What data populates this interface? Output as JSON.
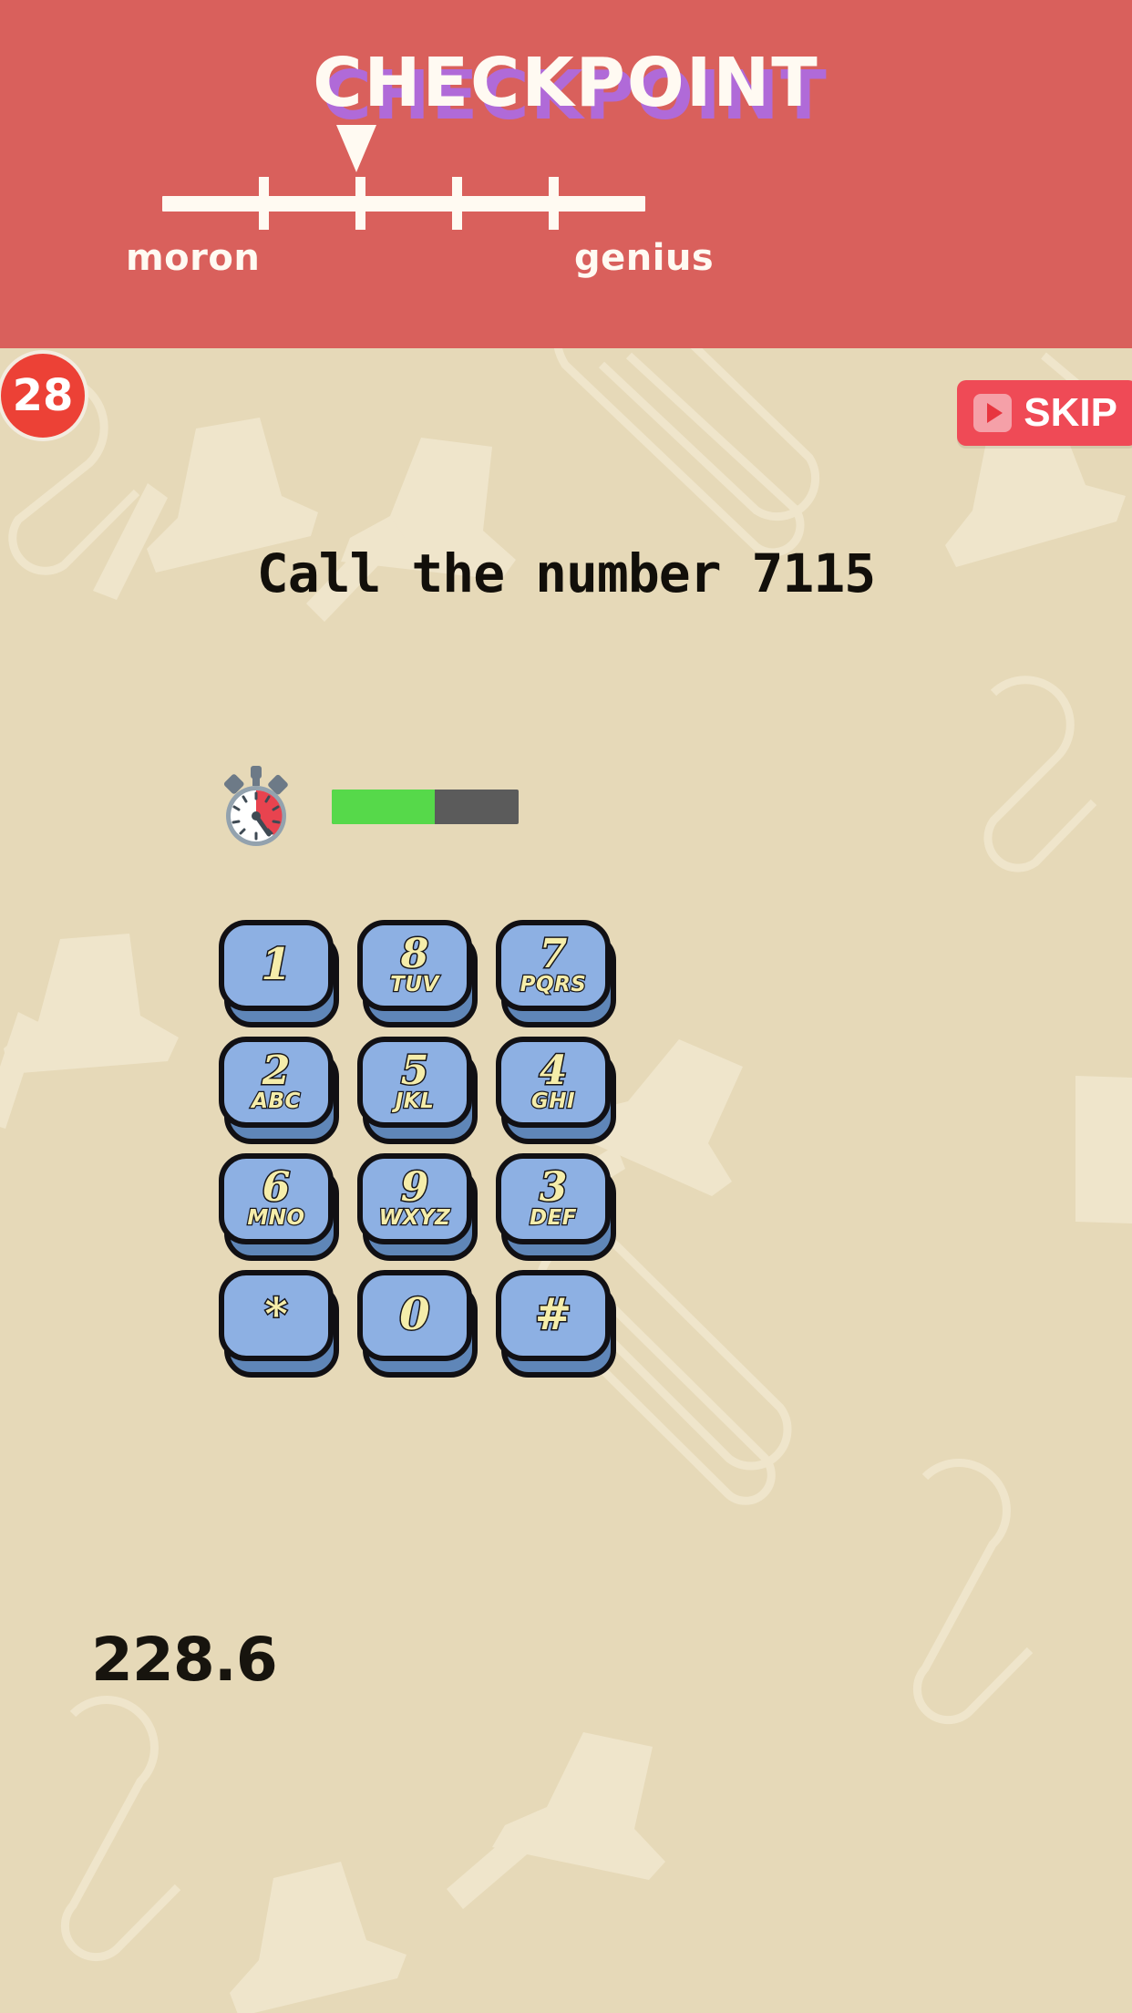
{
  "header": {
    "title": "CHECKPOINT",
    "title_color": "#fffaf2",
    "title_shadow_color": "#b06ad8",
    "background_color": "#d9605c",
    "label_low": "moron",
    "label_high": "genius",
    "pointer_position_percent": 38,
    "tick_positions_percent": [
      20,
      40,
      60,
      80
    ]
  },
  "hud": {
    "level_number": "28",
    "level_badge_color": "#ec4136",
    "skip_label": "SKIP",
    "skip_icon": "play-icon",
    "skip_button_color": "#ef4a56"
  },
  "question": {
    "prompt": "Call the number 7115",
    "target_number": "7115"
  },
  "timer": {
    "icon": "stopwatch-icon",
    "progress_percent": 55,
    "fill_color": "#56d94a",
    "track_color": "#5b5b5b"
  },
  "keypad": {
    "key_face_color": "#8db0e3",
    "key_edge_color": "#5f86b8",
    "key_text_color": "#f5edaa",
    "keys": [
      {
        "digit": "1",
        "letters": ""
      },
      {
        "digit": "8",
        "letters": "TUV"
      },
      {
        "digit": "7",
        "letters": "PQRS"
      },
      {
        "digit": "2",
        "letters": "ABC"
      },
      {
        "digit": "5",
        "letters": "JKL"
      },
      {
        "digit": "4",
        "letters": "GHI"
      },
      {
        "digit": "6",
        "letters": "MNO"
      },
      {
        "digit": "9",
        "letters": "WXYZ"
      },
      {
        "digit": "3",
        "letters": "DEF"
      },
      {
        "digit": "*",
        "letters": ""
      },
      {
        "digit": "0",
        "letters": ""
      },
      {
        "digit": "#",
        "letters": ""
      }
    ]
  },
  "score": {
    "value": "228.6"
  },
  "background": {
    "color": "#e6d9b8",
    "doodle_color": "#efe5cb",
    "doodles": "paperclips-and-pushpins"
  }
}
